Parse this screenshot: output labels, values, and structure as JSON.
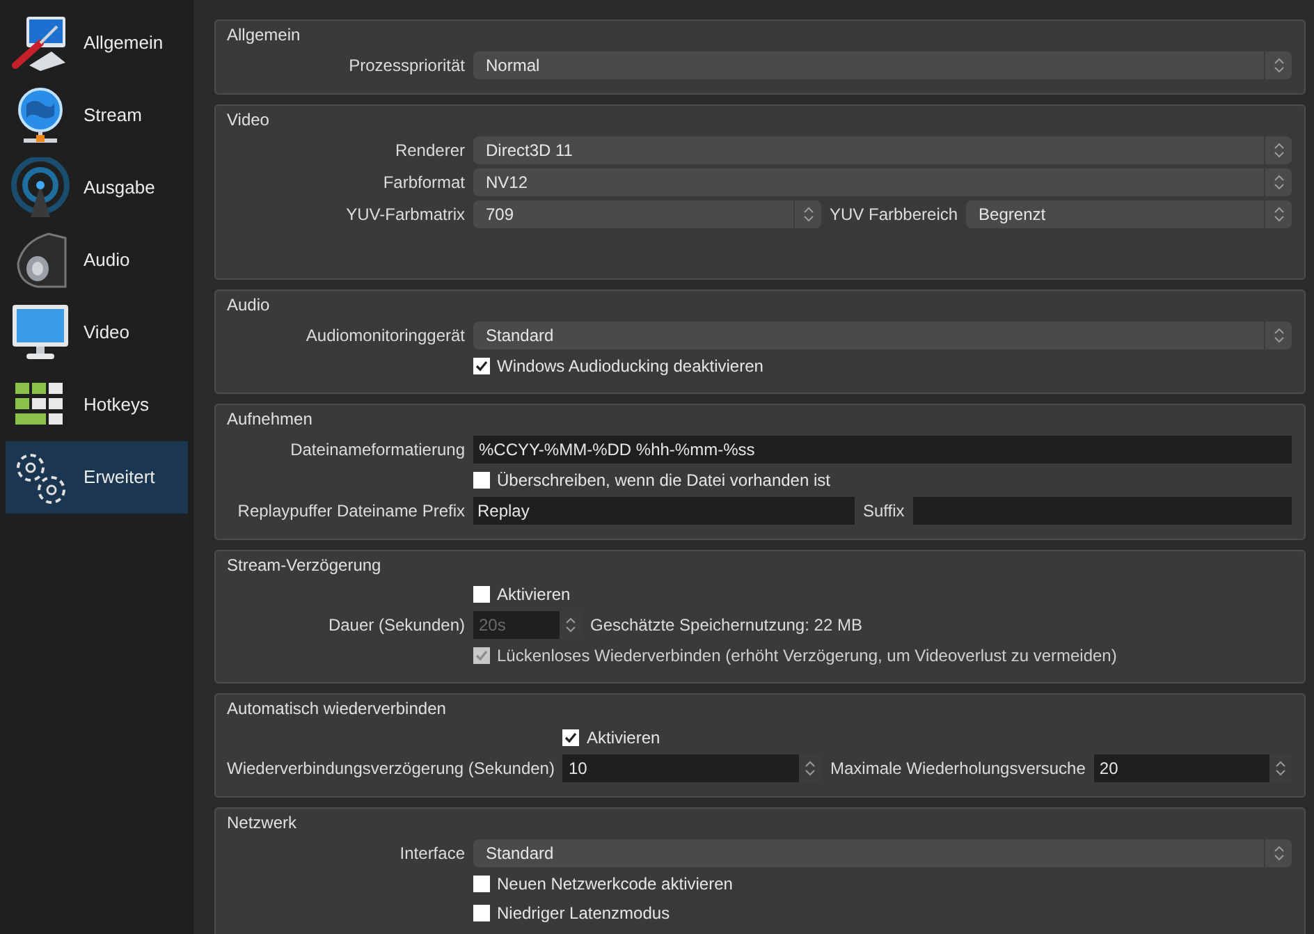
{
  "sidebar": {
    "items": [
      {
        "label": "Allgemein",
        "kind": "general",
        "selected": false
      },
      {
        "label": "Stream",
        "kind": "stream",
        "selected": false
      },
      {
        "label": "Ausgabe",
        "kind": "output",
        "selected": false
      },
      {
        "label": "Audio",
        "kind": "audio",
        "selected": false
      },
      {
        "label": "Video",
        "kind": "video",
        "selected": false
      },
      {
        "label": "Hotkeys",
        "kind": "hotkeys",
        "selected": false
      },
      {
        "label": "Erweitert",
        "kind": "advanced",
        "selected": true
      }
    ]
  },
  "sections": [
    {
      "title": "Allgemein",
      "rows": [
        {
          "kind": "select",
          "label": "Prozesspriorität",
          "value": "Normal"
        }
      ]
    },
    {
      "title": "Video",
      "rows": [
        {
          "kind": "select",
          "label": "Renderer",
          "value": "Direct3D 11"
        },
        {
          "kind": "select",
          "label": "Farbformat",
          "value": "NV12"
        },
        {
          "kind": "select_pair",
          "label": "YUV-Farbmatrix",
          "value": "709",
          "label2": "YUV Farbbereich",
          "value2": "Begrenzt"
        }
      ]
    },
    {
      "title": "Audio",
      "rows": [
        {
          "kind": "select",
          "label": "Audiomonitoringgerät",
          "value": "Standard"
        },
        {
          "kind": "checkbox",
          "label": "Windows Audioducking deaktivieren",
          "checked": true,
          "disabled": false
        }
      ]
    },
    {
      "title": "Aufnehmen",
      "rows": [
        {
          "kind": "input",
          "label": "Dateinameformatierung",
          "value": "%CCYY-%MM-%DD %hh-%mm-%ss"
        },
        {
          "kind": "checkbox",
          "label": "Überschreiben, wenn die Datei vorhanden ist",
          "checked": false,
          "disabled": false
        },
        {
          "kind": "input_pair",
          "label": "Replaypuffer Dateiname Prefix",
          "value": "Replay",
          "label2": "Suffix"
        }
      ]
    },
    {
      "title": "Stream-Verzögerung",
      "rows": [
        {
          "kind": "checkbox",
          "label": "Aktivieren",
          "checked": false,
          "disabled": false
        },
        {
          "kind": "spin_note",
          "label": "Dauer (Sekunden)",
          "value": "20s",
          "disabled": true,
          "note": "Geschätzte Speichernutzung: 22 MB"
        },
        {
          "kind": "checkbox",
          "label": "Lückenloses Wiederverbinden (erhöht Verzögerung, um Videoverlust zu vermeiden)",
          "checked": true,
          "disabled": true
        }
      ]
    },
    {
      "title": "Automatisch wiederverbinden",
      "rows": [
        {
          "kind": "checkbox",
          "label": "Aktivieren",
          "checked": true,
          "disabled": false
        },
        {
          "kind": "spin_pair",
          "label": "Wiederverbindungsverzögerung (Sekunden)",
          "value": "10",
          "label2": "Maximale Wiederholungsversuche",
          "value2": "20"
        }
      ]
    },
    {
      "title": "Netzwerk",
      "rows": [
        {
          "kind": "select",
          "label": "Interface",
          "value": "Standard"
        },
        {
          "kind": "checkbox",
          "label": "Neuen Netzwerkcode aktivieren",
          "checked": false,
          "disabled": false
        },
        {
          "kind": "checkbox",
          "label": "Niedriger Latenzmodus",
          "checked": false,
          "disabled": false
        }
      ]
    }
  ]
}
